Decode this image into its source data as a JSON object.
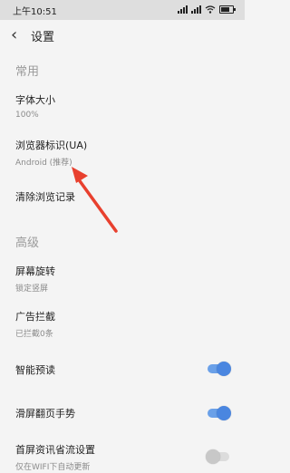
{
  "status_bar": {
    "time": "上午10:51"
  },
  "header": {
    "back_icon": "chevron-left-icon",
    "title": "设置"
  },
  "sections": {
    "common": "常用",
    "advanced": "高级"
  },
  "settings": {
    "font_size": {
      "label": "字体大小",
      "value": "100%"
    },
    "user_agent": {
      "label": "浏览器标识(UA)",
      "value": "Android (推荐)"
    },
    "clear_history": {
      "label": "清除浏览记录"
    },
    "rotation": {
      "label": "屏幕旋转",
      "value": "锁定竖屏"
    },
    "ad_block": {
      "label": "广告拦截",
      "value": "已拦截0条"
    },
    "smart_preread": {
      "label": "智能预读",
      "enabled": true
    },
    "swipe_page": {
      "label": "滑屏翻页手势",
      "enabled": true
    },
    "home_data_saver": {
      "label": "首屏资讯省流设置",
      "value": "仅在WIFI下自动更新",
      "enabled": false
    }
  },
  "colors": {
    "accent": "#4a86e0",
    "annotation_arrow": "#e8402e"
  }
}
